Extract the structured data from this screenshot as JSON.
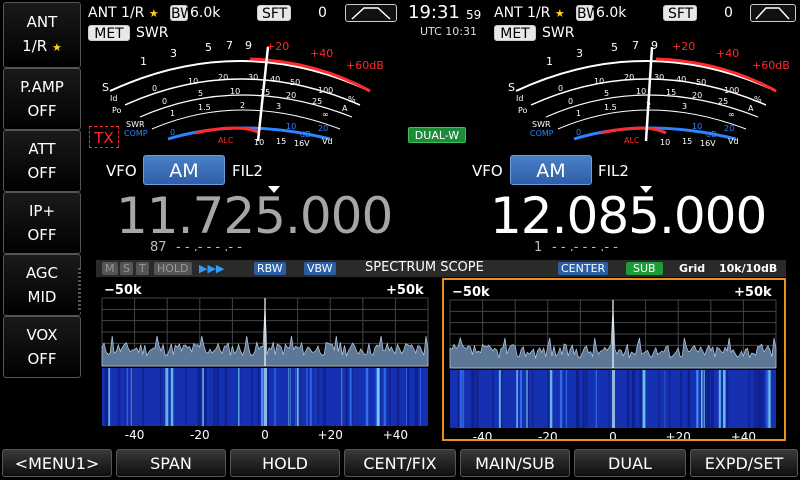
{
  "left_panel": {
    "buttons": [
      {
        "label": "ANT",
        "value": "1/R"
      },
      {
        "label": "P.AMP",
        "value": "OFF"
      },
      {
        "label": "ATT",
        "value": "OFF"
      },
      {
        "label": "IP+",
        "value": "OFF"
      },
      {
        "label": "AGC",
        "value": "MID"
      },
      {
        "label": "VOX",
        "value": "OFF"
      }
    ]
  },
  "status_left": {
    "ant": "ANT 1/R",
    "bw_label": "BW",
    "bw_value": "6.0k",
    "sft_label": "SFT",
    "sft_value": "0",
    "met": "MET",
    "swr": "SWR"
  },
  "status_right": {
    "ant": "ANT 1/R",
    "bw_label": "BW",
    "bw_value": "6.0k",
    "sft_label": "SFT",
    "sft_value": "0",
    "met": "MET",
    "swr": "SWR"
  },
  "clock": {
    "time": "19:31",
    "seconds": "59",
    "utc": "UTC 10:31"
  },
  "meter_scale": {
    "s_label": "S",
    "s_ticks": [
      "1",
      "3",
      "5",
      "7",
      "9"
    ],
    "over_ticks": [
      "+20",
      "+40",
      "+60dB"
    ],
    "po_label": "Po",
    "po_ticks": [
      "0",
      "10",
      "20",
      "30",
      "40",
      "50",
      "100",
      "%"
    ],
    "id_label": "Id",
    "id_ticks": [
      "0",
      "5",
      "10",
      "15",
      "20",
      "25",
      "A"
    ],
    "vd_ticks": [
      "1",
      "1.5",
      "2",
      "3",
      "∞"
    ],
    "swr_label": "SWR",
    "comp_label": "COMP",
    "comp_ticks": [
      "0",
      "10",
      "20"
    ],
    "db": "dB",
    "alc_label": "ALC",
    "vd_label": "Vd",
    "v_ticks": [
      "10",
      "15",
      "16V"
    ]
  },
  "tx_badge": "TX",
  "dual_badge": "DUAL-W",
  "vfo_left": {
    "vfo": "VFO",
    "mode": "AM",
    "filter": "FIL2",
    "freq": "11.725.000",
    "memo": "87",
    "memo_dashes": "- - .- - - .- -"
  },
  "vfo_right": {
    "vfo": "VFO",
    "mode": "AM",
    "filter": "FIL2",
    "freq": "12.085.000",
    "memo": "1",
    "memo_dashes": "- - .- - - .- -"
  },
  "scope": {
    "m": "M",
    "s": "S",
    "t": "T",
    "hold": "HOLD",
    "arrows": "▶▶▶",
    "rbw": "RBW",
    "vbw": "VBW",
    "title": "SPECTRUM SCOPE",
    "center": "CENTER",
    "sub": "SUB",
    "grid": "Grid",
    "scale": "10k/10dB",
    "span_left": "−50k",
    "span_right": "+50k",
    "axis_ticks": [
      "-40",
      "-20",
      "0",
      "+20",
      "+40"
    ]
  },
  "bottom_menu": [
    "<MENU1>",
    "SPAN",
    "HOLD",
    "CENT/FIX",
    "MAIN/SUB",
    "DUAL",
    "EXPD/SET"
  ],
  "colors": {
    "accent_blue": "#2f5ea6",
    "scale_red": "#ff2a2a",
    "scope_highlight": "#e8901e",
    "dual_green": "#1d8c3a",
    "waterfall_blue": "#1530b0"
  }
}
